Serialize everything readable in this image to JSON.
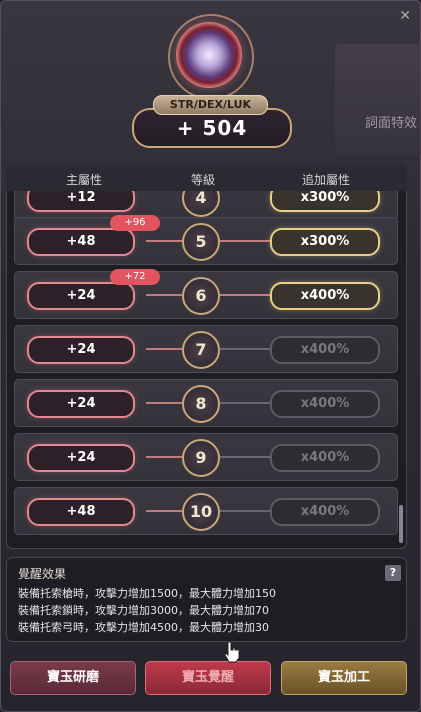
{
  "window": {
    "close_glyph": "✕"
  },
  "background": {
    "label": "詞面特效"
  },
  "header": {
    "stat_label": "STR/DEX/LUK",
    "stat_value": "+ 504"
  },
  "table": {
    "headers": [
      "主屬性",
      "等級",
      "追加屬性"
    ],
    "partial_row": {
      "main": "+12",
      "level": "4",
      "add": "x300%"
    },
    "rows": [
      {
        "main": "+48",
        "bonus": "+96",
        "level": "5",
        "add": "x300%",
        "active": true
      },
      {
        "main": "+24",
        "bonus": "+72",
        "level": "6",
        "add": "x400%",
        "active": true
      },
      {
        "main": "+24",
        "bonus": "",
        "level": "7",
        "add": "x400%",
        "active": false
      },
      {
        "main": "+24",
        "bonus": "",
        "level": "8",
        "add": "x400%",
        "active": false
      },
      {
        "main": "+24",
        "bonus": "",
        "level": "9",
        "add": "x400%",
        "active": false
      },
      {
        "main": "+48",
        "bonus": "",
        "level": "10",
        "add": "x400%",
        "active": false
      }
    ]
  },
  "effects": {
    "title": "覺醒效果",
    "help": "?",
    "lines": [
      "裝備托索槍時，攻擊力增加1500，最大體力增加150",
      "裝備托索鎖時，攻擊力增加3000，最大體力增加70",
      "裝備托索弓時，攻擊力增加4500，最大體力增加30"
    ]
  },
  "buttons": {
    "polish": "寶玉研磨",
    "awaken": "寶玉覺醒",
    "process": "寶玉加工"
  }
}
